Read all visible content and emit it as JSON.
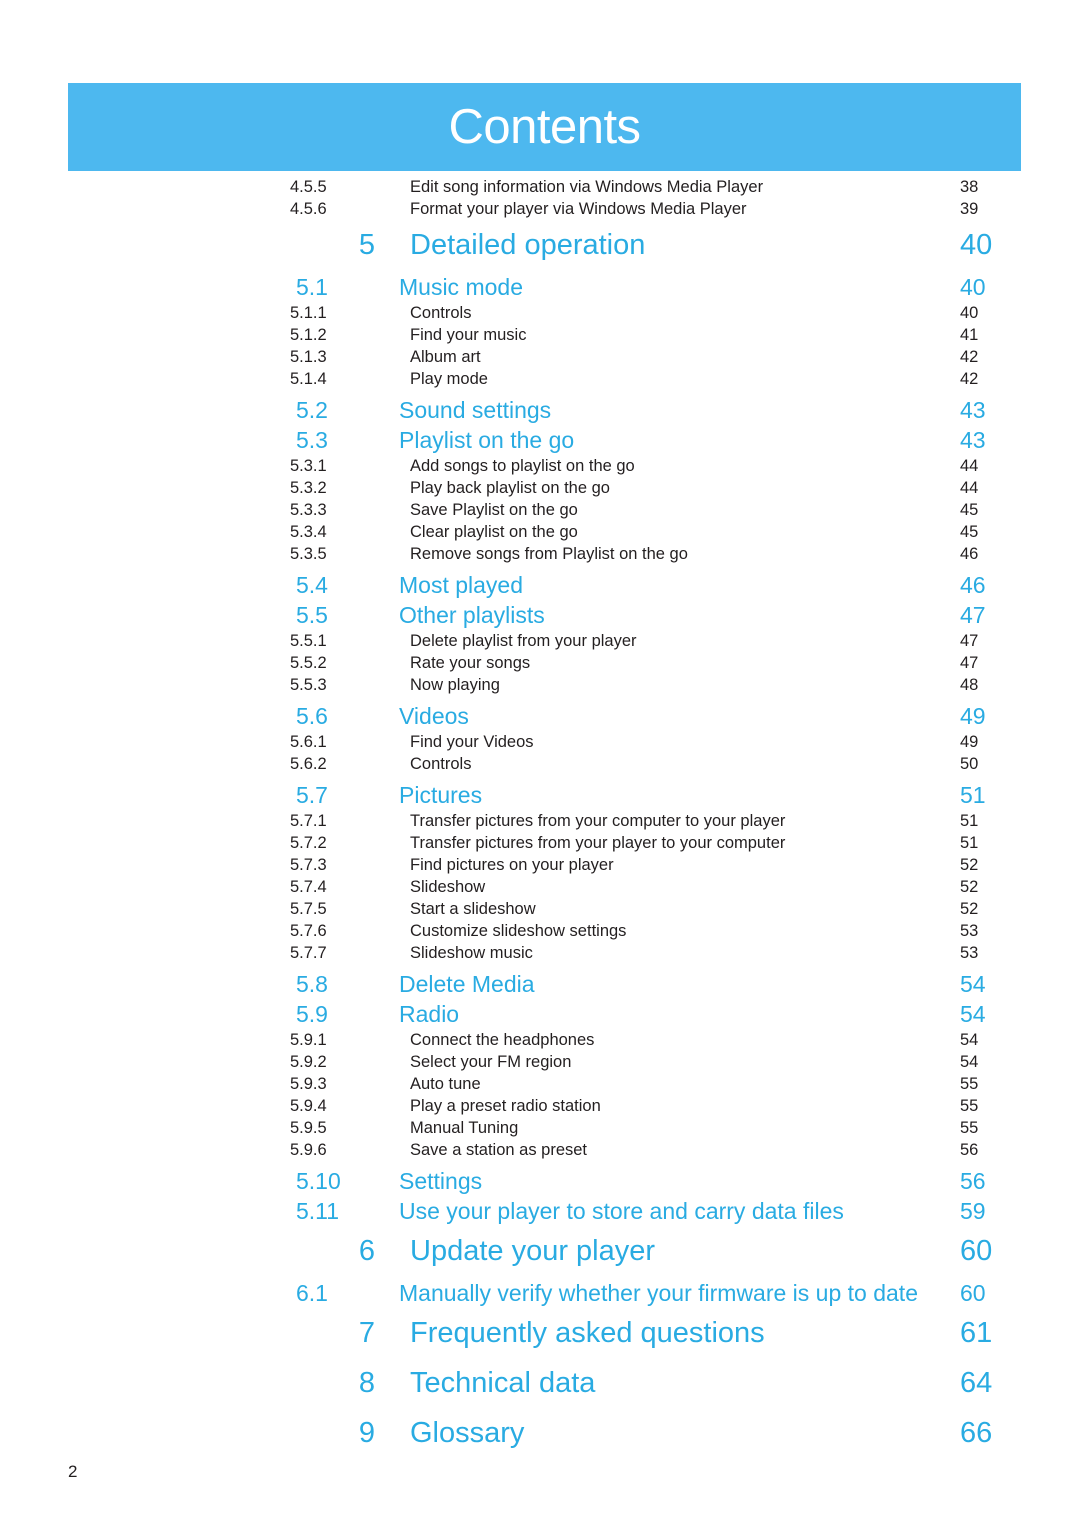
{
  "header": {
    "title": "Contents"
  },
  "page_footer": {
    "number": "2"
  },
  "colors": {
    "banner": "#4db8ef",
    "accent": "#29abe2",
    "text": "#231f20"
  },
  "toc": [
    {
      "level": 3,
      "num": "4.5.5",
      "title": "Edit song information via Windows Media Player",
      "page": "38"
    },
    {
      "level": 3,
      "num": "4.5.6",
      "title": "Format your player via Windows Media Player",
      "page": "39"
    },
    {
      "level": 1,
      "num": "5",
      "title": "Detailed operation",
      "page": "40"
    },
    {
      "level": 2,
      "num": "5.1",
      "title": "Music mode",
      "page": "40"
    },
    {
      "level": 3,
      "num": "5.1.1",
      "title": "Controls",
      "page": "40"
    },
    {
      "level": 3,
      "num": "5.1.2",
      "title": "Find your music",
      "page": "41"
    },
    {
      "level": 3,
      "num": "5.1.3",
      "title": "Album art",
      "page": "42"
    },
    {
      "level": 3,
      "num": "5.1.4",
      "title": "Play mode",
      "page": "42"
    },
    {
      "level": 2,
      "num": "5.2",
      "title": "Sound settings",
      "page": "43"
    },
    {
      "level": 2,
      "num": "5.3",
      "title": "Playlist on the go",
      "page": "43"
    },
    {
      "level": 3,
      "num": "5.3.1",
      "title": "Add songs to playlist on the go",
      "page": "44"
    },
    {
      "level": 3,
      "num": "5.3.2",
      "title": "Play back playlist on the go",
      "page": "44"
    },
    {
      "level": 3,
      "num": "5.3.3",
      "title": "Save Playlist on the go",
      "page": "45"
    },
    {
      "level": 3,
      "num": "5.3.4",
      "title": "Clear playlist on the go",
      "page": "45"
    },
    {
      "level": 3,
      "num": "5.3.5",
      "title": "Remove songs from Playlist on the go",
      "page": "46"
    },
    {
      "level": 2,
      "num": "5.4",
      "title": "Most played",
      "page": "46"
    },
    {
      "level": 2,
      "num": "5.5",
      "title": "Other playlists",
      "page": "47"
    },
    {
      "level": 3,
      "num": "5.5.1",
      "title": "Delete playlist from your player",
      "page": "47"
    },
    {
      "level": 3,
      "num": "5.5.2",
      "title": "Rate your songs",
      "page": "47"
    },
    {
      "level": 3,
      "num": "5.5.3",
      "title": "Now playing",
      "page": "48"
    },
    {
      "level": 2,
      "num": "5.6",
      "title": "Videos",
      "page": "49"
    },
    {
      "level": 3,
      "num": "5.6.1",
      "title": "Find your Videos",
      "page": "49"
    },
    {
      "level": 3,
      "num": "5.6.2",
      "title": "Controls",
      "page": "50"
    },
    {
      "level": 2,
      "num": "5.7",
      "title": "Pictures",
      "page": "51"
    },
    {
      "level": 3,
      "num": "5.7.1",
      "title": "Transfer pictures from your computer to your player",
      "page": "51"
    },
    {
      "level": 3,
      "num": "5.7.2",
      "title": "Transfer pictures from your player to your computer",
      "page": "51"
    },
    {
      "level": 3,
      "num": "5.7.3",
      "title": "Find pictures on your player",
      "page": "52"
    },
    {
      "level": 3,
      "num": "5.7.4",
      "title": "Slideshow",
      "page": "52"
    },
    {
      "level": 3,
      "num": "5.7.5",
      "title": "Start a slideshow",
      "page": "52"
    },
    {
      "level": 3,
      "num": "5.7.6",
      "title": "Customize slideshow settings",
      "page": "53"
    },
    {
      "level": 3,
      "num": "5.7.7",
      "title": "Slideshow music",
      "page": "53"
    },
    {
      "level": 2,
      "num": "5.8",
      "title": "Delete Media",
      "page": "54"
    },
    {
      "level": 2,
      "num": "5.9",
      "title": "Radio",
      "page": "54"
    },
    {
      "level": 3,
      "num": "5.9.1",
      "title": "Connect the headphones",
      "page": "54"
    },
    {
      "level": 3,
      "num": "5.9.2",
      "title": "Select your FM region",
      "page": "54"
    },
    {
      "level": 3,
      "num": "5.9.3",
      "title": "Auto tune",
      "page": "55"
    },
    {
      "level": 3,
      "num": "5.9.4",
      "title": "Play a preset radio station",
      "page": "55"
    },
    {
      "level": 3,
      "num": "5.9.5",
      "title": "Manual Tuning",
      "page": "55"
    },
    {
      "level": 3,
      "num": "5.9.6",
      "title": "Save a station as preset",
      "page": "56"
    },
    {
      "level": 2,
      "num": "5.10",
      "title": "Settings",
      "page": "56"
    },
    {
      "level": 2,
      "num": "5.11",
      "title": "Use your player to store and carry data files",
      "page": "59"
    },
    {
      "level": 1,
      "num": "6",
      "title": "Update your player",
      "page": "60"
    },
    {
      "level": 2,
      "num": "6.1",
      "title": "Manually verify whether your firmware is up to date",
      "page": "60"
    },
    {
      "level": 1,
      "num": "7",
      "title": "Frequently asked questions",
      "page": "61"
    },
    {
      "level": 1,
      "num": "8",
      "title": "Technical data",
      "page": "64"
    },
    {
      "level": 1,
      "num": "9",
      "title": "Glossary",
      "page": "66"
    }
  ]
}
